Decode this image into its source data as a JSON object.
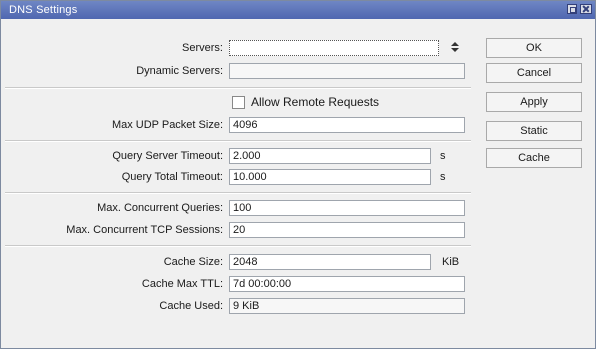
{
  "window": {
    "title": "DNS Settings"
  },
  "fields": {
    "servers": {
      "label": "Servers:",
      "value": ""
    },
    "dynamic_servers": {
      "label": "Dynamic Servers:",
      "value": ""
    },
    "allow_remote_requests": {
      "label": "Allow Remote Requests",
      "checked": false
    },
    "max_udp_packet_size": {
      "label": "Max UDP Packet Size:",
      "value": "4096"
    },
    "query_server_timeout": {
      "label": "Query Server Timeout:",
      "value": "2.000",
      "unit": "s"
    },
    "query_total_timeout": {
      "label": "Query Total Timeout:",
      "value": "10.000",
      "unit": "s"
    },
    "max_concurrent_queries": {
      "label": "Max. Concurrent Queries:",
      "value": "100"
    },
    "max_concurrent_tcp_sessions": {
      "label": "Max. Concurrent TCP Sessions:",
      "value": "20"
    },
    "cache_size": {
      "label": "Cache Size:",
      "value": "2048",
      "unit": "KiB"
    },
    "cache_max_ttl": {
      "label": "Cache Max TTL:",
      "value": "7d 00:00:00"
    },
    "cache_used": {
      "label": "Cache Used:",
      "value": "9 KiB"
    }
  },
  "buttons": {
    "ok": "OK",
    "cancel": "Cancel",
    "apply": "Apply",
    "static": "Static",
    "cache": "Cache"
  },
  "icons": {
    "spinner": "spinner-updown-icon",
    "restore": "restore-icon",
    "close": "close-icon"
  }
}
